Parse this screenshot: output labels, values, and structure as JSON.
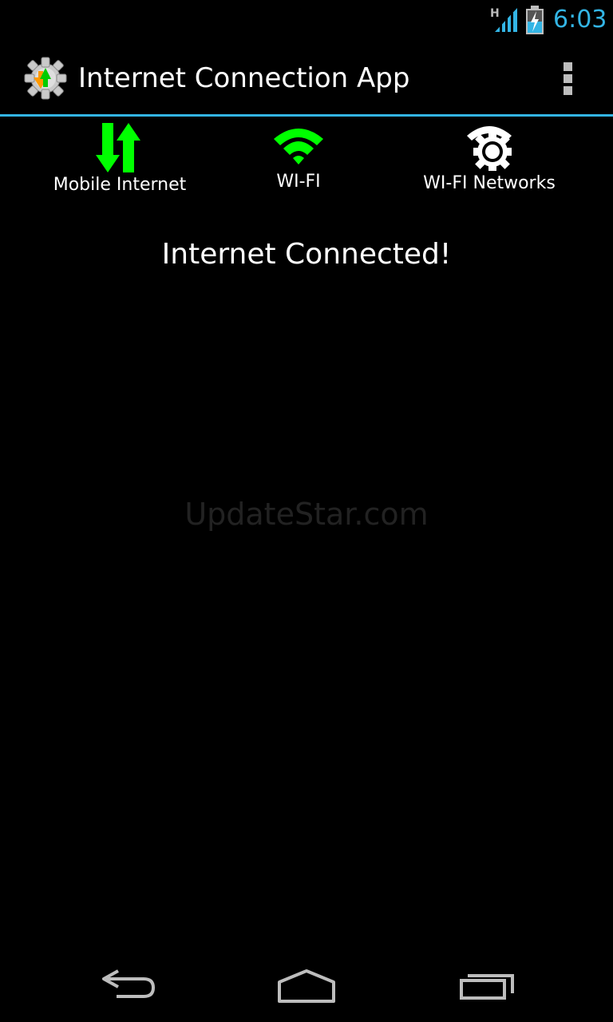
{
  "status_bar": {
    "network_type": "H",
    "time": "6:03",
    "accent_color": "#33b5e5"
  },
  "action_bar": {
    "title": "Internet Connection App",
    "icon": "app-gear-icon",
    "overflow_icon": "overflow-menu-icon"
  },
  "features": [
    {
      "label": "Mobile Internet",
      "icon": "mobile-data-arrows-icon",
      "color": "#00ff00"
    },
    {
      "label": "WI-FI",
      "icon": "wifi-icon",
      "color": "#00ff00"
    },
    {
      "label": "WI-FI Networks",
      "icon": "wifi-settings-gear-icon",
      "color": "#ffffff"
    }
  ],
  "status_message": "Internet Connected!",
  "watermark": "UpdateStar.com",
  "nav_bar": {
    "back_icon": "back-icon",
    "home_icon": "home-icon",
    "recent_icon": "recent-apps-icon"
  }
}
